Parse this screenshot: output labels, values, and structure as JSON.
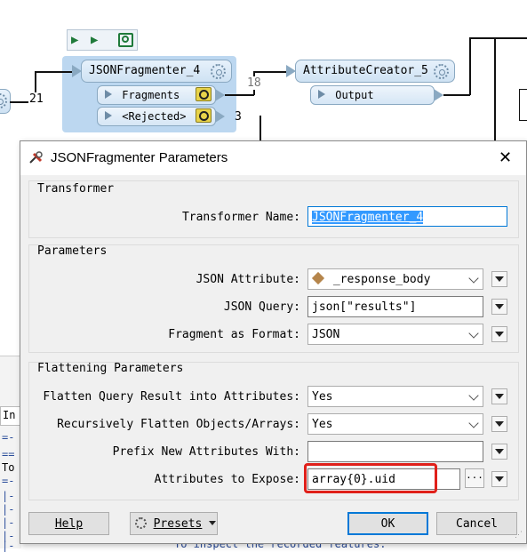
{
  "canvas": {
    "toolbar_icons": [
      "run-icon",
      "run-to-icon",
      "inspect-icon"
    ],
    "left_wire_label": "21",
    "output_count_fragments": "18",
    "output_count_rejected": "3",
    "fragmenter": {
      "name": "JSONFragmenter_4",
      "ports": [
        "Fragments",
        "<Rejected>"
      ]
    },
    "creator": {
      "name": "AttributeCreator_5",
      "port": "Output"
    },
    "log_lines": [
      "In",
      "=-",
      "==",
      "To",
      "=-",
      "|-",
      "|-",
      "|-",
      "|-",
      "|-"
    ],
    "log_footer": "To inspect the recorded features."
  },
  "dialog": {
    "title": "JSONFragmenter Parameters",
    "close_glyph": "✕",
    "transformer_group": {
      "title": "Transformer",
      "name_label": "Transformer Name:",
      "name_value": "JSONFragmenter_4"
    },
    "parameters_group": {
      "title": "Parameters",
      "json_attribute_label": "JSON Attribute:",
      "json_attribute_value": "_response_body",
      "json_query_label": "JSON Query:",
      "json_query_value": "json[\"results\"]",
      "fragment_format_label": "Fragment as Format:",
      "fragment_format_value": "JSON"
    },
    "flattening_group": {
      "title": "Flattening Parameters",
      "flatten_query_label": "Flatten Query Result into Attributes:",
      "flatten_query_value": "Yes",
      "recursive_label": "Recursively Flatten Objects/Arrays:",
      "recursive_value": "Yes",
      "prefix_label": "Prefix New Attributes With:",
      "prefix_value": "",
      "expose_label": "Attributes to Expose:",
      "expose_value": "array{0}.uid",
      "ellipsis": "···"
    },
    "buttons": {
      "help": "Help",
      "presets": "Presets",
      "ok": "OK",
      "cancel": "Cancel"
    },
    "highlight_color": "#e0201a"
  }
}
